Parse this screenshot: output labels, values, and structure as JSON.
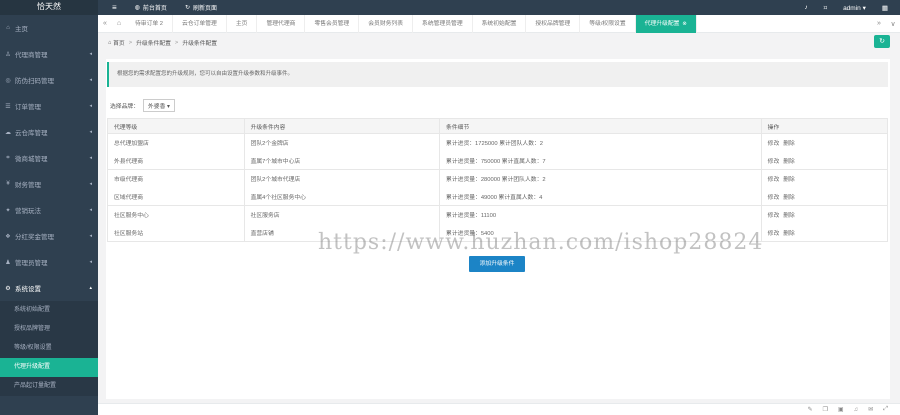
{
  "app": {
    "brand": "恰天然"
  },
  "sidebar": {
    "items": [
      {
        "label": "主页",
        "icon": "home-icon",
        "glyph": "⌂",
        "arrow": ""
      },
      {
        "label": "代理商管理",
        "icon": "user-icon",
        "glyph": "♙",
        "arrow": "◂"
      },
      {
        "label": "防伪扫码管理",
        "icon": "qrcode-icon",
        "glyph": "◎",
        "arrow": "◂"
      },
      {
        "label": "订单管理",
        "icon": "order-icon",
        "glyph": "☰",
        "arrow": "◂"
      },
      {
        "label": "云仓库管理",
        "icon": "cloud-icon",
        "glyph": "☁",
        "arrow": "◂"
      },
      {
        "label": "微商城管理",
        "icon": "shop-icon",
        "glyph": "⌗",
        "arrow": "◂"
      },
      {
        "label": "财务管理",
        "icon": "finance-icon",
        "glyph": "¥",
        "arrow": "◂"
      },
      {
        "label": "营销玩法",
        "icon": "marketing-icon",
        "glyph": "✦",
        "arrow": "◂"
      },
      {
        "label": "分红奖金管理",
        "icon": "bonus-icon",
        "glyph": "❖",
        "arrow": "◂"
      },
      {
        "label": "管理员管理",
        "icon": "admin-icon",
        "glyph": "♟",
        "arrow": "◂"
      },
      {
        "label": "系统设置",
        "icon": "gear-icon",
        "glyph": "⚙",
        "arrow": "▴"
      }
    ],
    "submenu": [
      {
        "label": "系统初始配置"
      },
      {
        "label": "授权品牌管理"
      },
      {
        "label": "等级/权限设置"
      },
      {
        "label": "代理升级配置"
      },
      {
        "label": "产品起订量配置"
      }
    ]
  },
  "topbar": {
    "menu_toggle": "≡",
    "front_link": "前台首页",
    "refresh_link": "刷新页面",
    "user": "admin ▾"
  },
  "tabs": [
    {
      "label": "待审订单 2"
    },
    {
      "label": "云仓订单管理"
    },
    {
      "label": "主页"
    },
    {
      "label": "管理代理商"
    },
    {
      "label": "零售会员管理"
    },
    {
      "label": "会员财务列表"
    },
    {
      "label": "系统管理员管理"
    },
    {
      "label": "系统初始配置"
    },
    {
      "label": "授权品牌管理"
    },
    {
      "label": "等级/权限设置"
    },
    {
      "label": "代理升级配置"
    }
  ],
  "breadcrumb": {
    "home": "首页",
    "level1": "升级条件配置",
    "level2": "升级条件配置"
  },
  "alert": "根据您的需求配置您的升级规则，您可以自由设置升级参数和升级事件。",
  "selector": {
    "label": "选择品牌：",
    "value": "外婆香 ▾"
  },
  "table": {
    "headers": [
      "代理等级",
      "升级条件内容",
      "条件细节",
      "操作"
    ],
    "rows": [
      {
        "level": "总代理加盟店",
        "condition": "团队2个金牌店",
        "detail": "累计进货：1725000 累计团队人数：2",
        "ops": [
          "修改",
          "删除"
        ],
        "end": false
      },
      {
        "level": "外县代理商",
        "condition": "直属7个城市中心店",
        "detail": "累计进货量：750000 累计直属人数：7",
        "ops": [
          "修改",
          "删除"
        ],
        "end": true
      },
      {
        "level": "市级代理商",
        "condition": "团队2个城市代理店",
        "detail": "累计进货量：280000 累计团队人数：2",
        "ops": [
          "修改",
          "删除"
        ],
        "end": false
      },
      {
        "level": "区域代理商",
        "condition": "直属4个社区服务中心",
        "detail": "累计进货量：49000 累计直属人数：4",
        "ops": [
          "修改",
          "删除"
        ],
        "end": true
      },
      {
        "level": "社区服务中心",
        "condition": "社区服务店",
        "detail": "累计进货量：11100",
        "ops": [
          "修改",
          "删除"
        ],
        "end": false
      },
      {
        "level": "社区服务站",
        "condition": "直营店铺",
        "detail": "累计进货量：5400",
        "ops": [
          "修改",
          "删除"
        ],
        "end": true
      }
    ]
  },
  "add_button": "添加升级条件",
  "watermark": "https://www.huzhan.com/ishop28824",
  "colors": {
    "sidebar": "#2f4050",
    "accent": "#1ab394",
    "primary": "#1c84c6"
  }
}
